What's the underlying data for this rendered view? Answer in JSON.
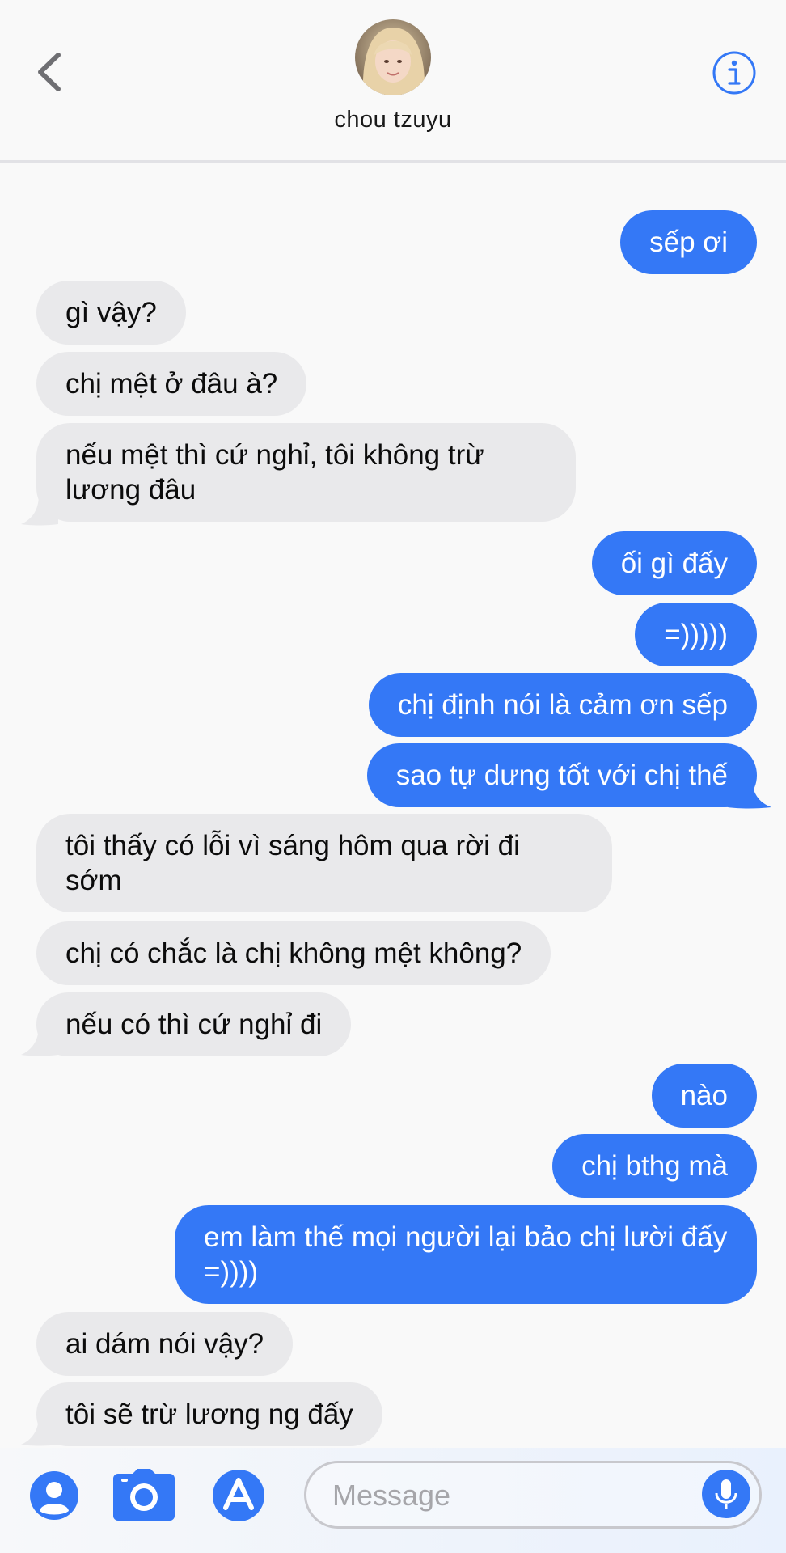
{
  "header": {
    "contact_name": "chou tzuyu",
    "back_icon": "chevron-left-icon",
    "info_icon": "info-icon"
  },
  "messages": [
    {
      "dir": "out",
      "text": "sếp ơi"
    },
    {
      "dir": "in",
      "text": "gì vậy?"
    },
    {
      "dir": "in",
      "text": "chị mệt ở đâu à?"
    },
    {
      "dir": "in",
      "text": "nếu mệt thì cứ nghỉ, tôi không trừ lương đâu"
    },
    {
      "dir": "out",
      "text": "ối gì đấy"
    },
    {
      "dir": "out",
      "text": "=)))))"
    },
    {
      "dir": "out",
      "text": "chị định nói là cảm ơn sếp"
    },
    {
      "dir": "out",
      "text": "sao tự dưng tốt với chị thế"
    },
    {
      "dir": "in",
      "text": "tôi thấy có lỗi vì sáng hôm qua rời đi sớm"
    },
    {
      "dir": "in",
      "text": "chị có chắc là chị không mệt không?"
    },
    {
      "dir": "in",
      "text": "nếu có thì cứ nghỉ đi"
    },
    {
      "dir": "out",
      "text": "nào"
    },
    {
      "dir": "out",
      "text": "chị bthg mà"
    },
    {
      "dir": "out",
      "text": "em làm thế mọi người lại bảo chị lười đấy =))))"
    },
    {
      "dir": "in",
      "text": "ai dám nói vậy?"
    },
    {
      "dir": "in",
      "text": "tôi sẽ trừ lương ng đấy"
    }
  ],
  "composer": {
    "placeholder": "Message",
    "icons": [
      "contacts-icon",
      "camera-icon",
      "app-store-icon",
      "microphone-icon"
    ]
  },
  "colors": {
    "outgoing_bubble": "#3478f6",
    "incoming_bubble": "#e9e9eb",
    "accent": "#3478f6",
    "background": "#f9f9f9"
  }
}
